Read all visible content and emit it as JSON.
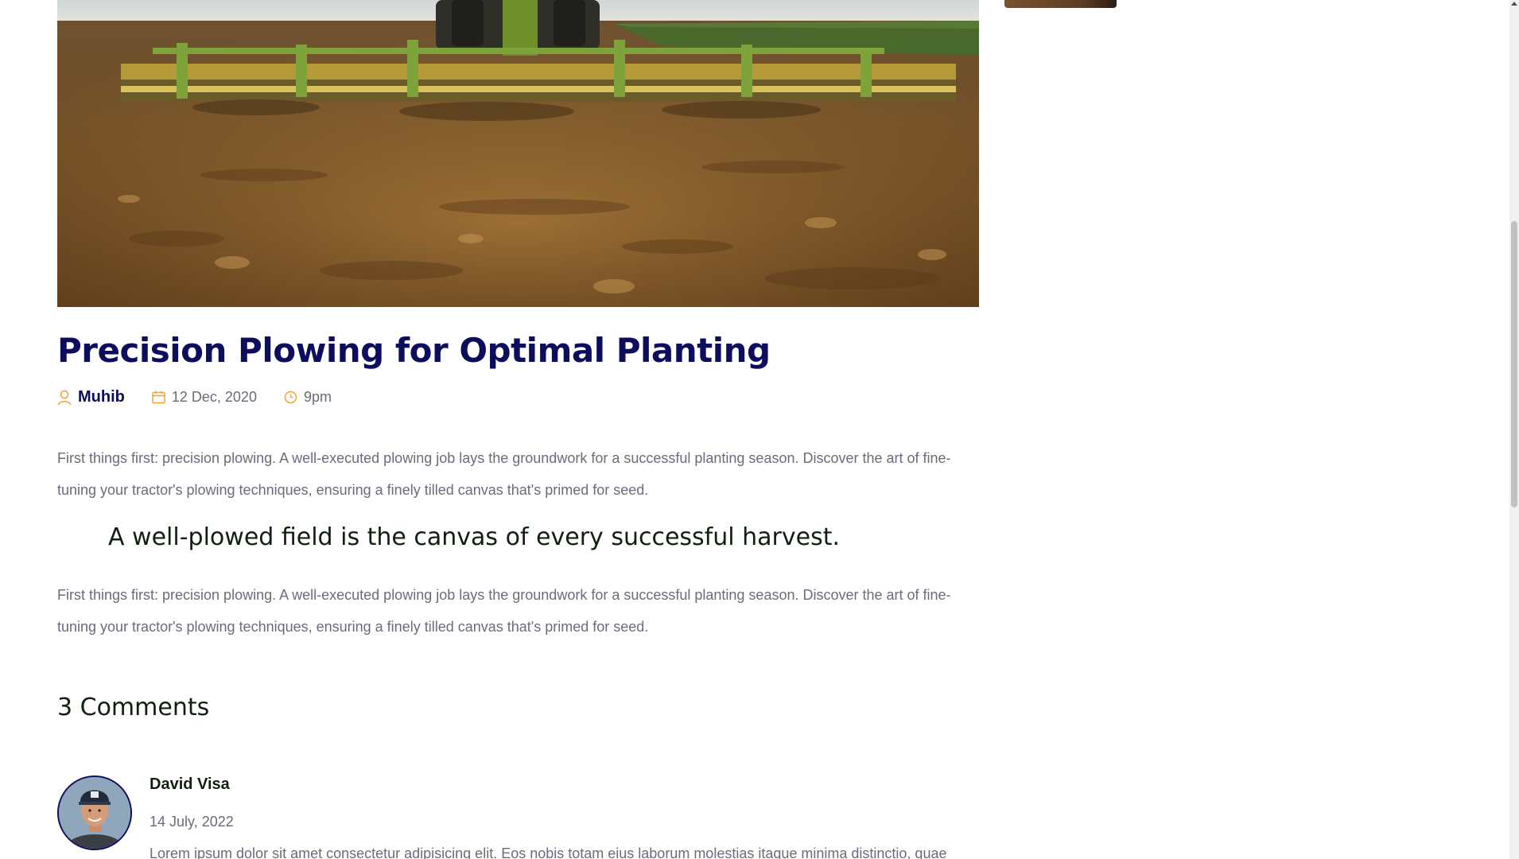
{
  "post": {
    "hero_image": "tractor-plowing-field-photo",
    "title": "Precision Plowing for Optimal Planting",
    "meta": {
      "author": "Muhib",
      "author_icon": "user-icon",
      "date": "12 Dec, 2020",
      "date_icon": "calendar-icon",
      "time": "9pm",
      "time_icon": "clock-icon"
    },
    "paragraph_1": "First things first: precision plowing. A well-executed plowing job lays the groundwork for a successful planting season. Discover the art of fine-tuning your tractor's plowing techniques, ensuring a finely tilled canvas that's primed for seed.",
    "quote": "A well-plowed field is the canvas of every successful harvest.",
    "paragraph_2": "First things first: precision plowing. A well-executed plowing job lays the groundwork for a successful planting season. Discover the art of fine-tuning your tractor's plowing techniques, ensuring a finely tilled canvas that's primed for seed."
  },
  "comments": {
    "heading": "3 Comments",
    "items": [
      {
        "author": "David Visa",
        "date": "14 July, 2022",
        "text": "Lorem ipsum dolor sit amet consectetur adipisicing elit. Eos nobis totam eius laborum molestias itaque minima distinctio, quae"
      }
    ]
  },
  "colors": {
    "title": "#0d0d5e",
    "accent_icon": "#f2a43a",
    "body_text": "#6b6b7b",
    "heading_text": "#102010"
  }
}
